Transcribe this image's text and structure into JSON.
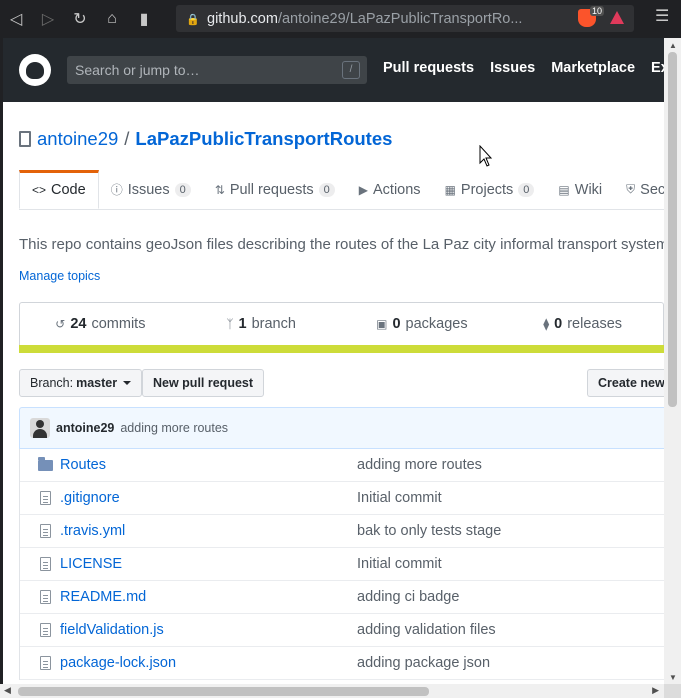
{
  "browser": {
    "url_host": "github.com",
    "url_path": "/antoine29/LaPazPublicTransportRo...",
    "shield_count": "10"
  },
  "header": {
    "search_placeholder": "Search or jump to…",
    "slash_key": "/",
    "nav": [
      "Pull requests",
      "Issues",
      "Marketplace",
      "Explore"
    ]
  },
  "repo": {
    "owner": "antoine29",
    "separator": "/",
    "name": "LaPazPublicTransportRoutes"
  },
  "tabs": [
    {
      "label": "Code",
      "icon": "code-icon"
    },
    {
      "label": "Issues",
      "count": "0",
      "icon": "issue-icon"
    },
    {
      "label": "Pull requests",
      "count": "0",
      "icon": "pr-icon"
    },
    {
      "label": "Actions",
      "icon": "play-icon"
    },
    {
      "label": "Projects",
      "count": "0",
      "icon": "project-icon"
    },
    {
      "label": "Wiki",
      "icon": "book-icon"
    },
    {
      "label": "Security",
      "icon": "shield-icon"
    }
  ],
  "description": "This repo contains geoJson files describing the routes of the La Paz city informal transport system",
  "manage_topics": "Manage topics",
  "summary": {
    "commits_count": "24",
    "commits_label": "commits",
    "branch_count": "1",
    "branch_label": "branch",
    "packages_count": "0",
    "packages_label": "packages",
    "releases_count": "0",
    "releases_label": "releases"
  },
  "branch_bar": {
    "branch_prefix": "Branch:",
    "branch_name": "master",
    "new_pr": "New pull request",
    "create_new": "Create new file"
  },
  "commit_tease": {
    "author": "antoine29",
    "message": "adding more routes"
  },
  "files": [
    {
      "type": "dir",
      "name": "Routes",
      "message": "adding more routes"
    },
    {
      "type": "file",
      "name": ".gitignore",
      "message": "Initial commit"
    },
    {
      "type": "file",
      "name": ".travis.yml",
      "message": "bak to only tests stage"
    },
    {
      "type": "file",
      "name": "LICENSE",
      "message": "Initial commit"
    },
    {
      "type": "file",
      "name": "README.md",
      "message": "adding ci badge"
    },
    {
      "type": "file",
      "name": "fieldValidation.js",
      "message": "adding validation files"
    },
    {
      "type": "file",
      "name": "package-lock.json",
      "message": "adding package json"
    }
  ],
  "colors": {
    "header_bg": "#24292e",
    "link": "#0366d6",
    "tab_accent": "#e36209",
    "language_bar": "#cddc39"
  }
}
